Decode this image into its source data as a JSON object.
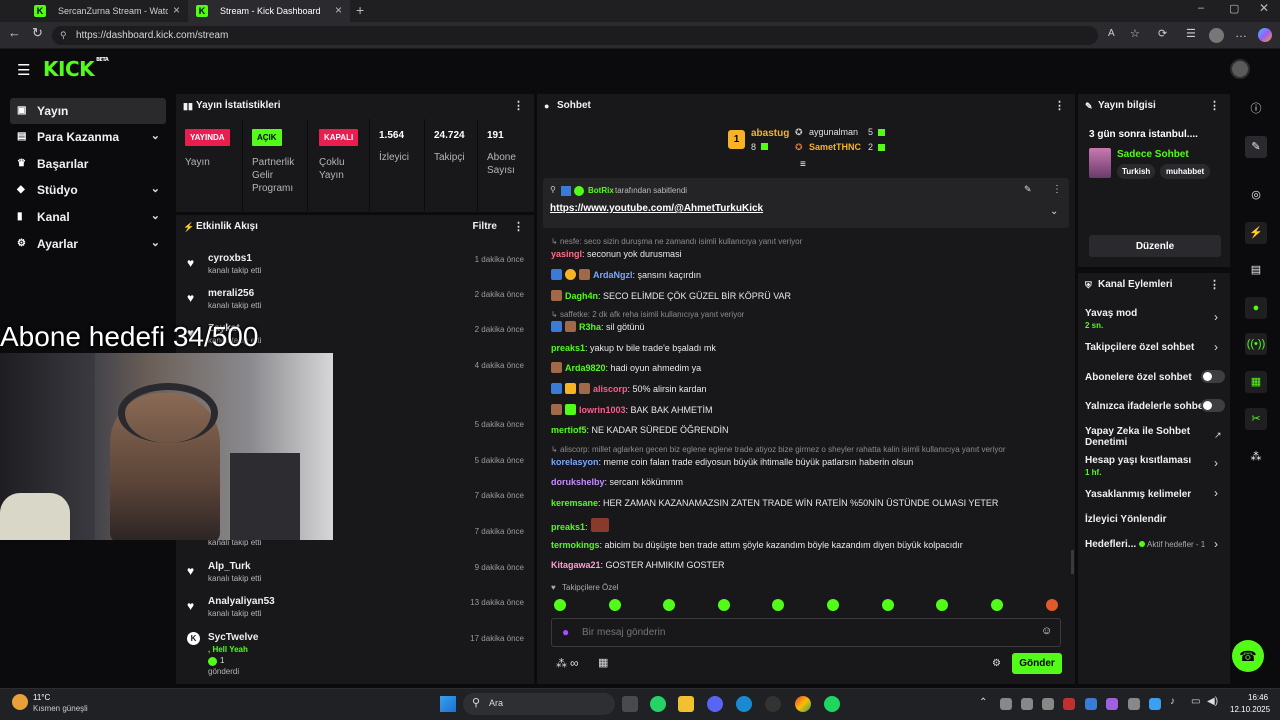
{
  "browser": {
    "tabs": [
      {
        "title": "SercanZurna Stream - Watch Live"
      },
      {
        "title": "Stream - Kick Dashboard"
      }
    ],
    "url": "https://dashboard.kick.com/stream"
  },
  "header": {
    "logo": "KICK",
    "logo_badge": "BETA"
  },
  "sidebar": {
    "items": [
      {
        "label": "Yayın"
      },
      {
        "label": "Para Kazanma"
      },
      {
        "label": "Başarılar"
      },
      {
        "label": "Stüdyo"
      },
      {
        "label": "Kanal"
      },
      {
        "label": "Ayarlar"
      }
    ]
  },
  "stats": {
    "title": "Yayın İstatistikleri",
    "items": [
      {
        "badge": "YAYINDA",
        "label": "Yayın",
        "badge_color": "#e91e4f"
      },
      {
        "badge": "AÇIK",
        "label": "Partnerlik Gelir Programı",
        "badge_color": "#53fc18"
      },
      {
        "badge": "KAPALI",
        "label": "Çoklu Yayın",
        "badge_color": "#e91e4f"
      },
      {
        "value": "1.564",
        "label": "İzleyici"
      },
      {
        "value": "24.724",
        "label": "Takipçi"
      },
      {
        "value": "191",
        "label": "Abone Sayısı"
      }
    ]
  },
  "activity": {
    "title": "Etkinlik Akışı",
    "filter": "Filtre",
    "rows": [
      {
        "name": "cyroxbs1",
        "action": "kanalı takip etti",
        "time": "1 dakika önce"
      },
      {
        "name": "merali256",
        "action": "kanalı takip etti",
        "time": "2 dakika önce"
      },
      {
        "name": "Zaykat",
        "action": "kanalı takip etti",
        "time": "2 dakika önce"
      },
      {
        "time": "4 dakika önce"
      },
      {
        "time": "5 dakika önce"
      },
      {
        "time": "5 dakika önce"
      },
      {
        "time": "7 dakika önce"
      },
      {
        "action": "kanalı takip etti",
        "time": "7 dakika önce"
      },
      {
        "name": "Alp_Turk",
        "action": "kanalı takip etti",
        "time": "9 dakika önce"
      },
      {
        "name": "Analyaliyan53",
        "action": "kanalı takip etti",
        "time": "13 dakika önce"
      },
      {
        "name": "SycTwelve",
        "action": ", Hell Yeah",
        "extra": "1",
        "extra2": "gönderdi",
        "time": "17 dakika önce"
      }
    ]
  },
  "overlay": {
    "goal": "Abone hedefi 34/500"
  },
  "chat": {
    "title": "Sohbet",
    "top": [
      {
        "rank": "1",
        "name": "abastug",
        "count": "8"
      },
      {
        "name": "aygunalman",
        "count": "5"
      },
      {
        "name": "SametTHNC",
        "count": "2"
      }
    ],
    "pinned": {
      "by": "BotRix",
      "by_suffix": "tarafından sabitlendi",
      "link": "https://www.youtube.com/@AhmetTurkuKick"
    },
    "messages": [
      {
        "reply": "nesfe: seco sizin duruşma ne zamandı isimli kullanıcıya yanıt veriyor"
      },
      {
        "user": "yasingl",
        "color": "#ff6b8b",
        "text": ": seconun yok durusmasi"
      },
      {
        "user": "ArdaNgzl",
        "color": "#7aa7ff",
        "text": ": şansını kaçırdın"
      },
      {
        "user": "Dagh4n",
        "color": "#53fc18",
        "text": ": SECO ELİMDE ÇÖK GÜZEL BİR KÖPRÜ VAR"
      },
      {
        "reply": "saffetke: 2 dk afk reha isimli kullanıcıya yanıt veriyor"
      },
      {
        "user": "R3ha",
        "color": "#53fc18",
        "text": ": sil götünü"
      },
      {
        "user": "preaks1",
        "color": "#53fc18",
        "text": ": yakup tv bile trade'e bşaladı mk"
      },
      {
        "user": "Arda9820",
        "color": "#53fc18",
        "text": ": hadi oyun ahmedim ya"
      },
      {
        "user": "aliscorp",
        "color": "#ff5c8a",
        "text": ": 50% alirsin kardan"
      },
      {
        "user": "lowrin1003",
        "color": "#ff5c8a",
        "text": ": BAK BAK AHMETİM"
      },
      {
        "user": "mertiof5",
        "color": "#53fc18",
        "text": ": NE KADAR SÜREDE ÖĞRENDİN"
      },
      {
        "reply": "aliscorp: millet aglarken gecen biz eglene eglene trade atiyoz bize girmez o sheyler rahatta kalin isimli kullanıcıya yanıt veriyor"
      },
      {
        "user": "korelasyon",
        "color": "#7aa7ff",
        "text": ": meme coin falan trade ediyosun büyük ihtimalle büyük patlarsın haberin olsun"
      },
      {
        "user": "dorukshelby",
        "color": "#c58cff",
        "text": ": sercanı kökümmm"
      },
      {
        "user": "keremsane",
        "color": "#53fc18",
        "text": ": HER ZAMAN KAZANAMAZSIN ZATEN TRADE WİN RATEİN %50NİN ÜSTÜNDE OLMASI YETER"
      },
      {
        "user": "preaks1",
        "color": "#53fc18",
        "text": ":"
      },
      {
        "user": "termokings",
        "color": "#53fc18",
        "text": ": abicim bu düşüşte ben trade attım şöyle kazandım böyle kazandım diyen büyük kolpacıdır"
      },
      {
        "user": "Kitagawa21",
        "color": "#ff9ecf",
        "text": ": GOSTER AHMIKIM GOSTER"
      }
    ],
    "followers_only": "Takipçilere Özel",
    "input_placeholder": "Bir mesaj gönderin",
    "send": "Gönder"
  },
  "stream_info": {
    "title": "Yayın bilgisi",
    "stream_title": "3 gün sonra istanbul....",
    "category": "Sadece Sohbet",
    "tags": [
      "Turkish",
      "muhabbet"
    ],
    "edit": "Düzenle"
  },
  "channel_actions": {
    "title": "Kanal Eylemleri",
    "items": [
      {
        "label": "Yavaş mod",
        "sub": "2 sn."
      },
      {
        "label": "Takipçilere özel sohbet"
      },
      {
        "label": "Abonelere özel sohbet"
      },
      {
        "label": "Yalnızca ifadelerle sohbet"
      },
      {
        "label": "Yapay Zeka ile Sohbet Denetimi"
      },
      {
        "label": "Hesap yaşı kısıtlaması",
        "sub": "1 hf."
      },
      {
        "label": "Yasaklanmış kelimeler"
      },
      {
        "label": "İzleyici Yönlendir"
      },
      {
        "label": "Hedefleri...",
        "sub": "Aktif hedefler - 1"
      }
    ]
  },
  "taskbar": {
    "weather_temp": "11°C",
    "weather_desc": "Kısmen güneşli",
    "search": "Ara",
    "time": "16:46",
    "date": "12.10.2025"
  }
}
